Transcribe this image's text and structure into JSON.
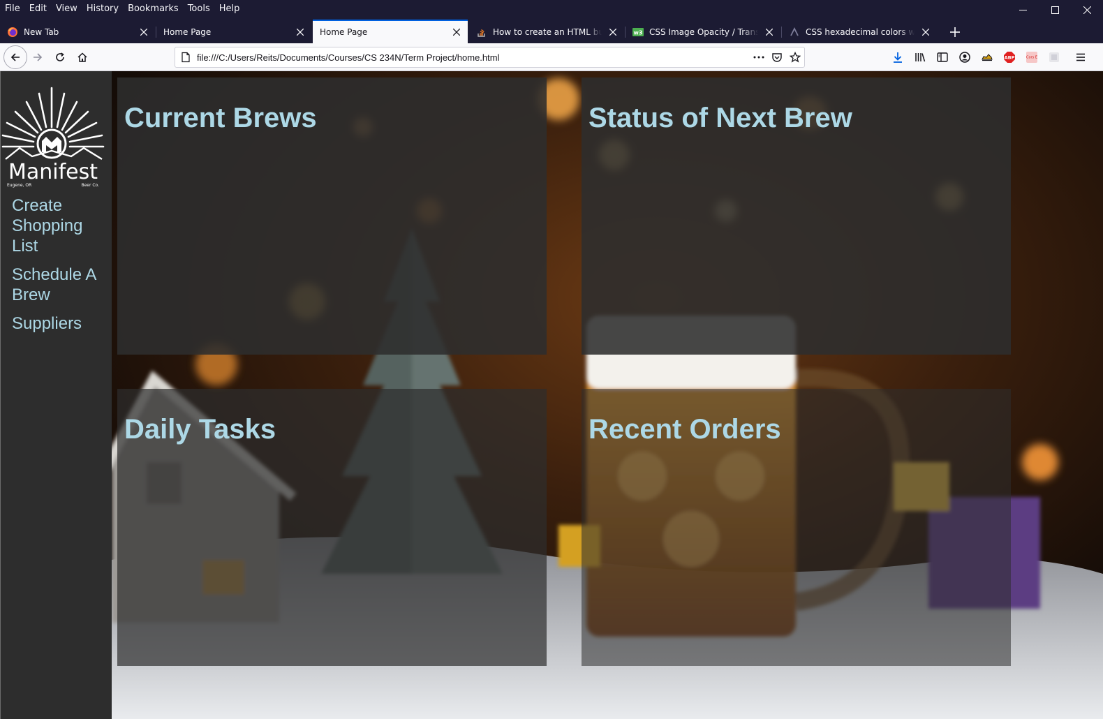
{
  "menu": {
    "items": [
      "File",
      "Edit",
      "View",
      "History",
      "Bookmarks",
      "Tools",
      "Help"
    ]
  },
  "tabs": [
    {
      "title": "New Tab",
      "icon": "firefox-icon"
    },
    {
      "title": "Home Page",
      "icon": "none"
    },
    {
      "title": "Home Page",
      "icon": "none",
      "active": true
    },
    {
      "title": "How to create an HTML button",
      "icon": "stackoverflow-icon"
    },
    {
      "title": "CSS Image Opacity / Transparency",
      "icon": "w3schools-icon"
    },
    {
      "title": "CSS hexadecimal colors with transparency",
      "icon": "site-icon"
    }
  ],
  "navbar": {
    "url": "file:///C:/Users/Reits/Documents/Courses/CS 234N/Term Project/home.html",
    "extension_labels": {
      "abp": "ABP",
      "cors": "Cors E"
    }
  },
  "sidebar": {
    "logo": {
      "brand": "Manifest",
      "location": "Eugene, OR",
      "suffix": "Beer Co."
    },
    "links": [
      "Create Shopping List",
      "Schedule A Brew",
      "Suppliers"
    ]
  },
  "panels": {
    "current_brews": "Current Brews",
    "next_brew": "Status of Next Brew",
    "daily_tasks": "Daily Tasks",
    "recent_orders": "Recent Orders"
  },
  "colors": {
    "heading": "#add8e6",
    "sidebar_bg": "#2d2d2d",
    "chrome_dark": "#1c1b33",
    "tab_active_accent": "#0061e0"
  }
}
